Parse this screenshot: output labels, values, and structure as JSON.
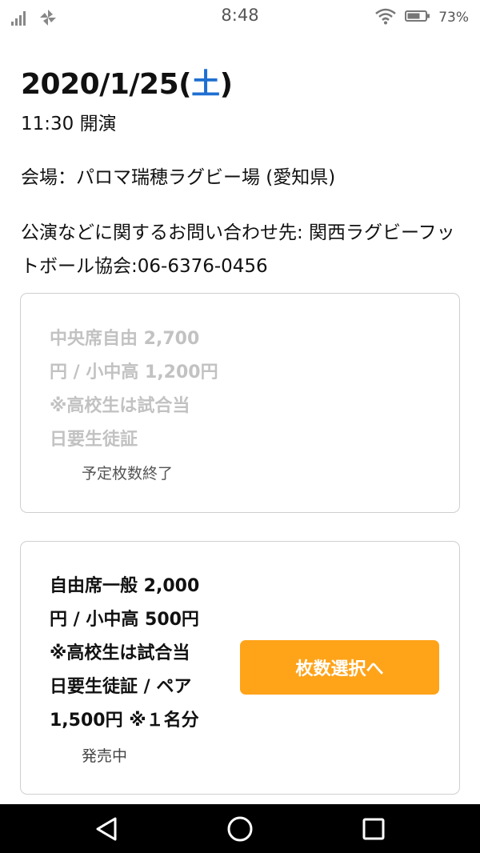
{
  "status_bar": {
    "time": "8:48",
    "battery_percent": "73%",
    "icons": [
      "signal-icon",
      "pinwheel-icon",
      "wifi-icon",
      "battery-icon"
    ]
  },
  "event": {
    "date": "2020/1/25(",
    "day_of_week": "土",
    "date_close": ")",
    "start_time": "11:30 開演",
    "venue": "会場：パロマ瑞穂ラグビー場 (愛知県)",
    "contact": "公演などに関するお問い合わせ先: 関西ラグビーフットボール協会:06-6376-0456"
  },
  "tickets": [
    {
      "description_lines": [
        "中央席自由 2,700",
        "円 / 小中高 1,200円",
        "※高校生は試合当",
        "日要生徒証"
      ],
      "status": "予定枚数終了",
      "available": false
    },
    {
      "description_lines": [
        "自由席一般 2,000",
        "円 / 小中高 500円",
        "※高校生は試合当",
        "日要生徒証 / ペア",
        "1,500円 ※１名分"
      ],
      "status": "発売中",
      "available": true,
      "button_label": "枚数選択へ"
    }
  ],
  "colors": {
    "accent_orange": "#ffa319",
    "day_of_week_blue": "#1f6fd1",
    "disabled_text": "#c2c2c2"
  },
  "nav_bar": {
    "icons": [
      "back-icon",
      "home-icon",
      "recents-icon"
    ]
  }
}
